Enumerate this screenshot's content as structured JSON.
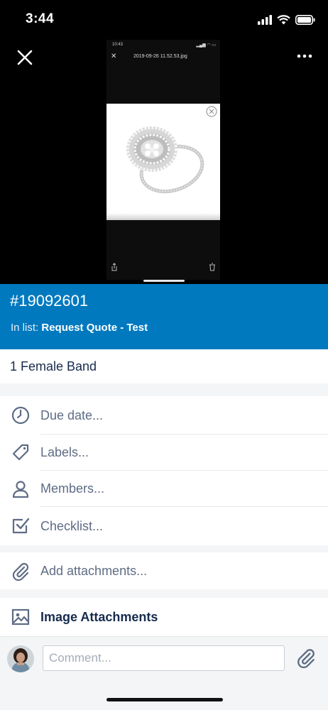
{
  "status_bar": {
    "time": "3:44"
  },
  "preview": {
    "inner_status_time": "10:43",
    "inner_file_name": "2019-09-26 11.52.53.jpg"
  },
  "card": {
    "id": "#19092601",
    "in_list_prefix": "In list:",
    "list_name": "Request Quote - Test",
    "title": "1 Female Band"
  },
  "actions": [
    {
      "label": "Due date...",
      "icon": "clock-icon"
    },
    {
      "label": "Labels...",
      "icon": "tag-icon"
    },
    {
      "label": "Members...",
      "icon": "person-icon"
    },
    {
      "label": "Checklist...",
      "icon": "checkbox-icon"
    }
  ],
  "attachments": {
    "label": "Add attachments...",
    "icon": "paperclip-icon"
  },
  "image_attachments": {
    "label": "Image Attachments",
    "icon": "image-icon"
  },
  "comment": {
    "placeholder": "Comment..."
  },
  "colors": {
    "header_blue": "#0079bf",
    "icon_gray": "#5e6c84",
    "text_dark": "#172b4d"
  }
}
